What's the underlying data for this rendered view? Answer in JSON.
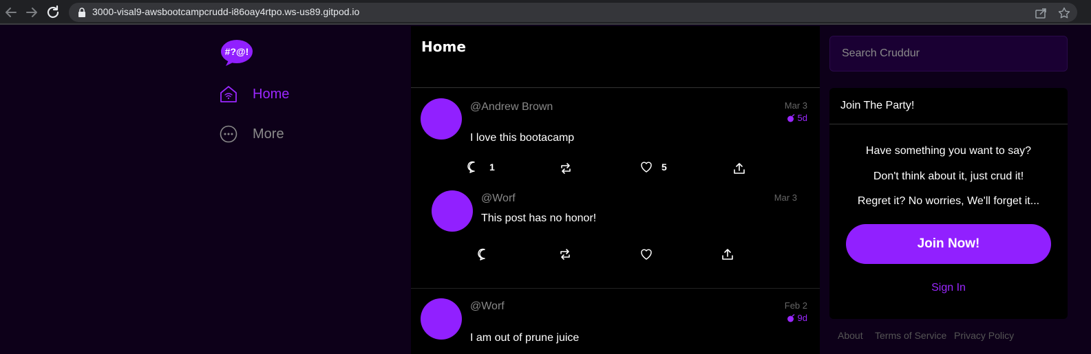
{
  "browser": {
    "url": "3000-visal9-awsbootcampcrudd-i86oay4rtpo.ws-us89.gitpod.io"
  },
  "logo": {
    "text": "#?@!"
  },
  "nav": {
    "home": "Home",
    "more": "More"
  },
  "feed": {
    "title": "Home",
    "posts": [
      {
        "handle": "@Andrew Brown",
        "message": "I love this bootacamp",
        "date": "Mar 3",
        "expires": "5d",
        "replies": "1",
        "likes": "5",
        "reply": {
          "handle": "@Worf",
          "message": "This post has no honor!",
          "date": "Mar 3"
        }
      },
      {
        "handle": "@Worf",
        "message": "I am out of prune juice",
        "date": "Feb 2",
        "expires": "9d"
      }
    ]
  },
  "search": {
    "placeholder": "Search Cruddur"
  },
  "party": {
    "title": "Join The Party!",
    "line1": "Have something you want to say?",
    "line2": "Don't think about it, just crud it!",
    "line3": "Regret it? No worries, We'll forget it...",
    "join_label": "Join Now!",
    "signin_label": "Sign In"
  },
  "footer": {
    "about": "About",
    "terms": "Terms of Service",
    "privacy": "Privacy Policy"
  },
  "colors": {
    "accent": "#9120ff",
    "background": "#0d0019",
    "panel": "#000000"
  }
}
